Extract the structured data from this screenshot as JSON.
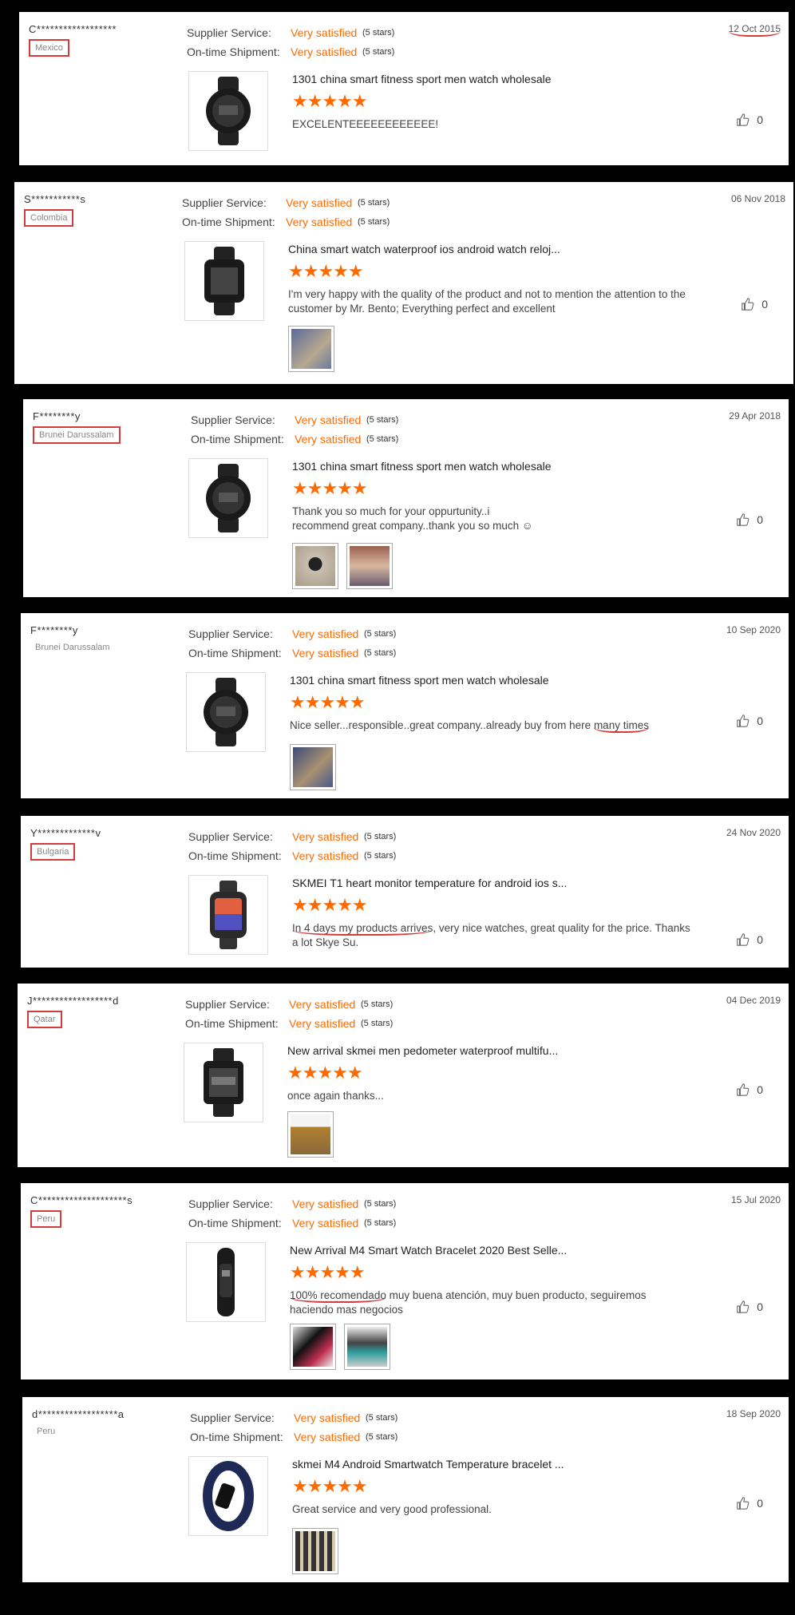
{
  "labels": {
    "supplier_service": "Supplier Service:",
    "on_time_shipment": "On-time Shipment:"
  },
  "colors": {
    "accent": "#ff6a00",
    "annotation": "#d23c3c"
  },
  "reviews": [
    {
      "buyer": "C******************",
      "country": "Mexico",
      "supplier_rating": "Very satisfied",
      "supplier_stars": "(5 stars)",
      "shipment_rating": "Very satisfied",
      "shipment_stars": "(5 stars)",
      "date": "12 Oct 2015",
      "product": "1301 china smart fitness sport men watch wholesale",
      "stars": "★★★★★",
      "comment": "EXCELENTEEEEEEEEEEEE!",
      "likes": "0",
      "photo_icons": []
    },
    {
      "buyer": "S***********s",
      "country": "Colombia",
      "supplier_rating": "Very satisfied",
      "supplier_stars": "(5 stars)",
      "shipment_rating": "Very satisfied",
      "shipment_stars": "(5 stars)",
      "date": "06 Nov 2018",
      "product": "China smart watch waterproof ios android watch reloj...",
      "stars": "★★★★★",
      "comment": "I'm very happy with the quality of the product and not to mention the attention to the customer by Mr. Bento; Everything perfect and excellent",
      "likes": "0",
      "photo_icons": [
        "package-photo"
      ]
    },
    {
      "buyer": "F********y",
      "country": "Brunei Darussalam",
      "supplier_rating": "Very satisfied",
      "supplier_stars": "(5 stars)",
      "shipment_rating": "Very satisfied",
      "shipment_stars": "(5 stars)",
      "date": "29 Apr 2018",
      "product": "1301 china smart fitness sport men watch wholesale",
      "stars": "★★★★★",
      "comment": "Thank you so much for your oppurtunity..i recommend great company..thank you so much ☺",
      "likes": "0",
      "photo_icons": [
        "watch-photo",
        "people-photo"
      ]
    },
    {
      "buyer": "F********y",
      "country": "Brunei Darussalam",
      "supplier_rating": "Very satisfied",
      "supplier_stars": "(5 stars)",
      "shipment_rating": "Very satisfied",
      "shipment_stars": "(5 stars)",
      "date": "10 Sep 2020",
      "product": "1301 china smart fitness sport men watch wholesale",
      "stars": "★★★★★",
      "comment_before": "Nice seller...responsible..great company..already buy from here ",
      "comment_marked": "many times",
      "comment_after": "",
      "likes": "0",
      "photo_icons": [
        "package-photo"
      ]
    },
    {
      "buyer": "Y*************v",
      "country": "Bulgaria",
      "supplier_rating": "Very satisfied",
      "supplier_stars": "(5 stars)",
      "shipment_rating": "Very satisfied",
      "shipment_stars": "(5 stars)",
      "date": "24 Nov 2020",
      "product": "SKMEI T1 heart monitor temperature for android ios s...",
      "stars": "★★★★★",
      "comment_before": "",
      "comment_marked": "In 4 days my products arrives",
      "comment_after": ", very nice watches, great quality for the price. Thanks a lot Skye Su.",
      "likes": "0",
      "photo_icons": []
    },
    {
      "buyer": "J******************d",
      "country": "Qatar",
      "supplier_rating": "Very satisfied",
      "supplier_stars": "(5 stars)",
      "shipment_rating": "Very satisfied",
      "shipment_stars": "(5 stars)",
      "date": "04 Dec 2019",
      "product": "New arrival skmei men pedometer waterproof multifu...",
      "stars": "★★★★★",
      "comment": "once again thanks...",
      "likes": "0",
      "photo_icons": [
        "box-photo"
      ]
    },
    {
      "buyer": "C********************s",
      "country": "Peru",
      "supplier_rating": "Very satisfied",
      "supplier_stars": "(5 stars)",
      "shipment_rating": "Very satisfied",
      "shipment_stars": "(5 stars)",
      "date": "15 Jul 2020",
      "product": "New Arrival M4 Smart Watch Bracelet 2020 Best Selle...",
      "stars": "★★★★★",
      "comment_before": "",
      "comment_marked": "100% recomendado",
      "comment_after": " muy buena atención, muy buen producto, seguiremos haciendo mas negocios",
      "likes": "0",
      "photo_icons": [
        "band-photo",
        "band-box-photo"
      ]
    },
    {
      "buyer": "d******************a",
      "country": "Peru",
      "supplier_rating": "Very satisfied",
      "supplier_stars": "(5 stars)",
      "shipment_rating": "Very satisfied",
      "shipment_stars": "(5 stars)",
      "date": "18 Sep 2020",
      "product": "skmei M4 Android Smartwatch Temperature bracelet ...",
      "stars": "★★★★★",
      "comment": "Great service and very good professional.",
      "likes": "0",
      "photo_icons": [
        "bands-photo"
      ]
    }
  ]
}
